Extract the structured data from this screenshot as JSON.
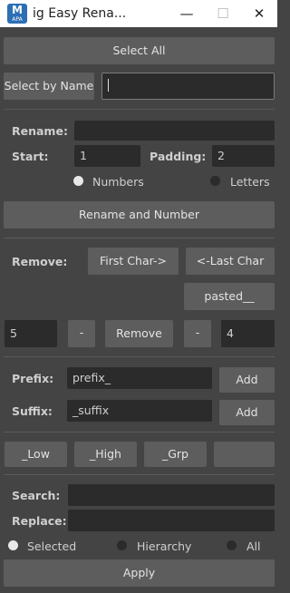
{
  "window": {
    "title": "ig Easy Rena...",
    "icon_letter": "M",
    "icon_sub": "APA",
    "minimize": "—",
    "maximize": "☐",
    "close": "✕"
  },
  "select": {
    "select_all": "Select All",
    "select_by_name": "Select by Name",
    "name_value": ""
  },
  "rename": {
    "rename_label": "Rename:",
    "rename_value": "",
    "start_label": "Start:",
    "start_value": "1",
    "padding_label": "Padding:",
    "padding_value": "2",
    "numbers_label": "Numbers",
    "letters_label": "Letters",
    "action": "Rename and Number"
  },
  "remove": {
    "label": "Remove:",
    "first_char": "First Char->",
    "last_char": "<-Last Char",
    "pasted": "pasted__",
    "left_value": "5",
    "left_minus": "-",
    "remove_button": "Remove",
    "right_minus": "-",
    "right_value": "4"
  },
  "affix": {
    "prefix_label": "Prefix:",
    "prefix_value": "prefix_",
    "prefix_add": "Add",
    "suffix_label": "Suffix:",
    "suffix_value": "_suffix",
    "suffix_add": "Add"
  },
  "quick": {
    "low": "_Low",
    "high": "_High",
    "grp": "_Grp",
    "blank": ""
  },
  "replace": {
    "search_label": "Search:",
    "search_value": "",
    "replace_label": "Replace:",
    "replace_value": "",
    "selected_label": "Selected",
    "hierarchy_label": "Hierarchy",
    "all_label": "All",
    "apply": "Apply"
  }
}
